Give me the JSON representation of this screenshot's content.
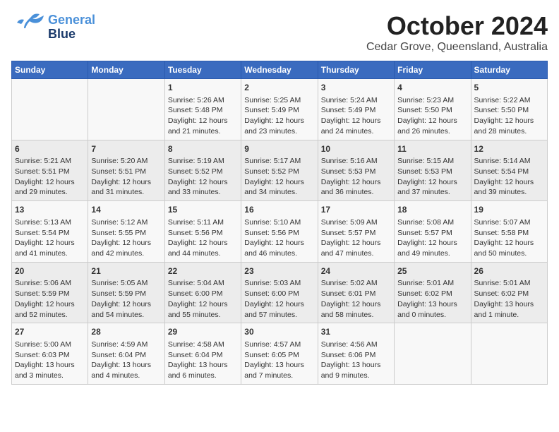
{
  "header": {
    "logo_line1": "General",
    "logo_line2": "Blue",
    "month": "October 2024",
    "location": "Cedar Grove, Queensland, Australia"
  },
  "days_of_week": [
    "Sunday",
    "Monday",
    "Tuesday",
    "Wednesday",
    "Thursday",
    "Friday",
    "Saturday"
  ],
  "weeks": [
    [
      {
        "day": "",
        "content": ""
      },
      {
        "day": "",
        "content": ""
      },
      {
        "day": "1",
        "content": "Sunrise: 5:26 AM\nSunset: 5:48 PM\nDaylight: 12 hours and 21 minutes."
      },
      {
        "day": "2",
        "content": "Sunrise: 5:25 AM\nSunset: 5:49 PM\nDaylight: 12 hours and 23 minutes."
      },
      {
        "day": "3",
        "content": "Sunrise: 5:24 AM\nSunset: 5:49 PM\nDaylight: 12 hours and 24 minutes."
      },
      {
        "day": "4",
        "content": "Sunrise: 5:23 AM\nSunset: 5:50 PM\nDaylight: 12 hours and 26 minutes."
      },
      {
        "day": "5",
        "content": "Sunrise: 5:22 AM\nSunset: 5:50 PM\nDaylight: 12 hours and 28 minutes."
      }
    ],
    [
      {
        "day": "6",
        "content": "Sunrise: 5:21 AM\nSunset: 5:51 PM\nDaylight: 12 hours and 29 minutes."
      },
      {
        "day": "7",
        "content": "Sunrise: 5:20 AM\nSunset: 5:51 PM\nDaylight: 12 hours and 31 minutes."
      },
      {
        "day": "8",
        "content": "Sunrise: 5:19 AM\nSunset: 5:52 PM\nDaylight: 12 hours and 33 minutes."
      },
      {
        "day": "9",
        "content": "Sunrise: 5:17 AM\nSunset: 5:52 PM\nDaylight: 12 hours and 34 minutes."
      },
      {
        "day": "10",
        "content": "Sunrise: 5:16 AM\nSunset: 5:53 PM\nDaylight: 12 hours and 36 minutes."
      },
      {
        "day": "11",
        "content": "Sunrise: 5:15 AM\nSunset: 5:53 PM\nDaylight: 12 hours and 37 minutes."
      },
      {
        "day": "12",
        "content": "Sunrise: 5:14 AM\nSunset: 5:54 PM\nDaylight: 12 hours and 39 minutes."
      }
    ],
    [
      {
        "day": "13",
        "content": "Sunrise: 5:13 AM\nSunset: 5:54 PM\nDaylight: 12 hours and 41 minutes."
      },
      {
        "day": "14",
        "content": "Sunrise: 5:12 AM\nSunset: 5:55 PM\nDaylight: 12 hours and 42 minutes."
      },
      {
        "day": "15",
        "content": "Sunrise: 5:11 AM\nSunset: 5:56 PM\nDaylight: 12 hours and 44 minutes."
      },
      {
        "day": "16",
        "content": "Sunrise: 5:10 AM\nSunset: 5:56 PM\nDaylight: 12 hours and 46 minutes."
      },
      {
        "day": "17",
        "content": "Sunrise: 5:09 AM\nSunset: 5:57 PM\nDaylight: 12 hours and 47 minutes."
      },
      {
        "day": "18",
        "content": "Sunrise: 5:08 AM\nSunset: 5:57 PM\nDaylight: 12 hours and 49 minutes."
      },
      {
        "day": "19",
        "content": "Sunrise: 5:07 AM\nSunset: 5:58 PM\nDaylight: 12 hours and 50 minutes."
      }
    ],
    [
      {
        "day": "20",
        "content": "Sunrise: 5:06 AM\nSunset: 5:59 PM\nDaylight: 12 hours and 52 minutes."
      },
      {
        "day": "21",
        "content": "Sunrise: 5:05 AM\nSunset: 5:59 PM\nDaylight: 12 hours and 54 minutes."
      },
      {
        "day": "22",
        "content": "Sunrise: 5:04 AM\nSunset: 6:00 PM\nDaylight: 12 hours and 55 minutes."
      },
      {
        "day": "23",
        "content": "Sunrise: 5:03 AM\nSunset: 6:00 PM\nDaylight: 12 hours and 57 minutes."
      },
      {
        "day": "24",
        "content": "Sunrise: 5:02 AM\nSunset: 6:01 PM\nDaylight: 12 hours and 58 minutes."
      },
      {
        "day": "25",
        "content": "Sunrise: 5:01 AM\nSunset: 6:02 PM\nDaylight: 13 hours and 0 minutes."
      },
      {
        "day": "26",
        "content": "Sunrise: 5:01 AM\nSunset: 6:02 PM\nDaylight: 13 hours and 1 minute."
      }
    ],
    [
      {
        "day": "27",
        "content": "Sunrise: 5:00 AM\nSunset: 6:03 PM\nDaylight: 13 hours and 3 minutes."
      },
      {
        "day": "28",
        "content": "Sunrise: 4:59 AM\nSunset: 6:04 PM\nDaylight: 13 hours and 4 minutes."
      },
      {
        "day": "29",
        "content": "Sunrise: 4:58 AM\nSunset: 6:04 PM\nDaylight: 13 hours and 6 minutes."
      },
      {
        "day": "30",
        "content": "Sunrise: 4:57 AM\nSunset: 6:05 PM\nDaylight: 13 hours and 7 minutes."
      },
      {
        "day": "31",
        "content": "Sunrise: 4:56 AM\nSunset: 6:06 PM\nDaylight: 13 hours and 9 minutes."
      },
      {
        "day": "",
        "content": ""
      },
      {
        "day": "",
        "content": ""
      }
    ]
  ]
}
